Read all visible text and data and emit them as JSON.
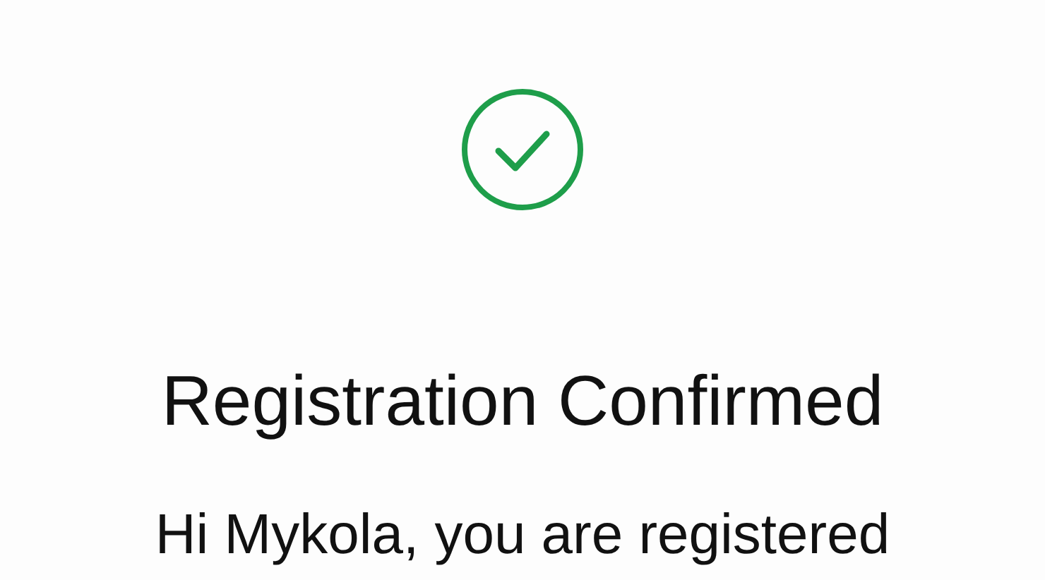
{
  "title": "Registration Confirmed",
  "message": "Hi Mykola, you are registered"
}
